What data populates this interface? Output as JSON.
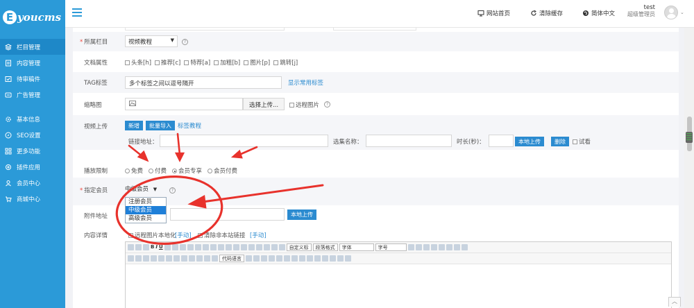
{
  "logo": {
    "mark": "E",
    "text": "youcms"
  },
  "sidebar": {
    "items": [
      {
        "label": "栏目管理",
        "icon": "layers-icon",
        "active": true
      },
      {
        "label": "内容管理",
        "icon": "document-icon"
      },
      {
        "label": "待审稿件",
        "icon": "review-icon"
      },
      {
        "label": "广告管理",
        "icon": "ad-icon"
      },
      {
        "label": "基本信息",
        "icon": "gear-icon"
      },
      {
        "label": "SEO设置",
        "icon": "compass-icon"
      },
      {
        "label": "更多功能",
        "icon": "grid-icon"
      },
      {
        "label": "插件应用",
        "icon": "plugin-icon"
      },
      {
        "label": "会员中心",
        "icon": "user-icon"
      },
      {
        "label": "商城中心",
        "icon": "cart-icon"
      }
    ]
  },
  "topbar": {
    "site_home": "网站首页",
    "clear_cache": "清除缓存",
    "language": "简体中文",
    "username": "test",
    "role": "超级管理员"
  },
  "form": {
    "column": {
      "label": "所属栏目",
      "value": "视频教程"
    },
    "attrs": {
      "label": "文档属性",
      "options": [
        "头条[h]",
        "推荐[c]",
        "特荐[a]",
        "加粗[b]",
        "图片[p]",
        "跳转[j]"
      ]
    },
    "tag": {
      "label": "TAG标签",
      "value": "多个标签之间以逗号隔开",
      "link": "显示常用标签"
    },
    "thumb": {
      "label": "缩略图",
      "upload_btn": "选择上传...",
      "remote": "远程图片"
    },
    "video": {
      "label": "视频上传",
      "btn_new": "新增",
      "btn_batch": "批量导入",
      "tutorial": "标签教程",
      "link_label": "链接地址：",
      "name_label": "选集名称：",
      "duration_label": "时长(秒)：",
      "local_upload": "本地上传",
      "delete": "删除",
      "trial": "试看"
    },
    "playback": {
      "label": "播放限制",
      "options": [
        "免费",
        "付费",
        "会员专享",
        "会员付费"
      ],
      "selected": 2
    },
    "member": {
      "label": "指定会员",
      "value": "中级会员",
      "options": [
        "注册会员",
        "中级会员",
        "高级会员"
      ],
      "selected": 1
    },
    "attachment": {
      "label": "附件地址",
      "upload": "本地上传"
    },
    "content": {
      "label": "内容详情",
      "localize": "远程图片本地化",
      "localize_manual": "[手动]",
      "remove_links": "清除非本站链接",
      "remove_manual": "[手动]"
    }
  },
  "editor": {
    "custom_title": "自定义标",
    "para_format": "段落格式",
    "font": "字体",
    "size": "字号",
    "code_lang": "代码语言"
  },
  "colors": {
    "accent": "#2b9ad8",
    "annotation": "#e8322c"
  }
}
